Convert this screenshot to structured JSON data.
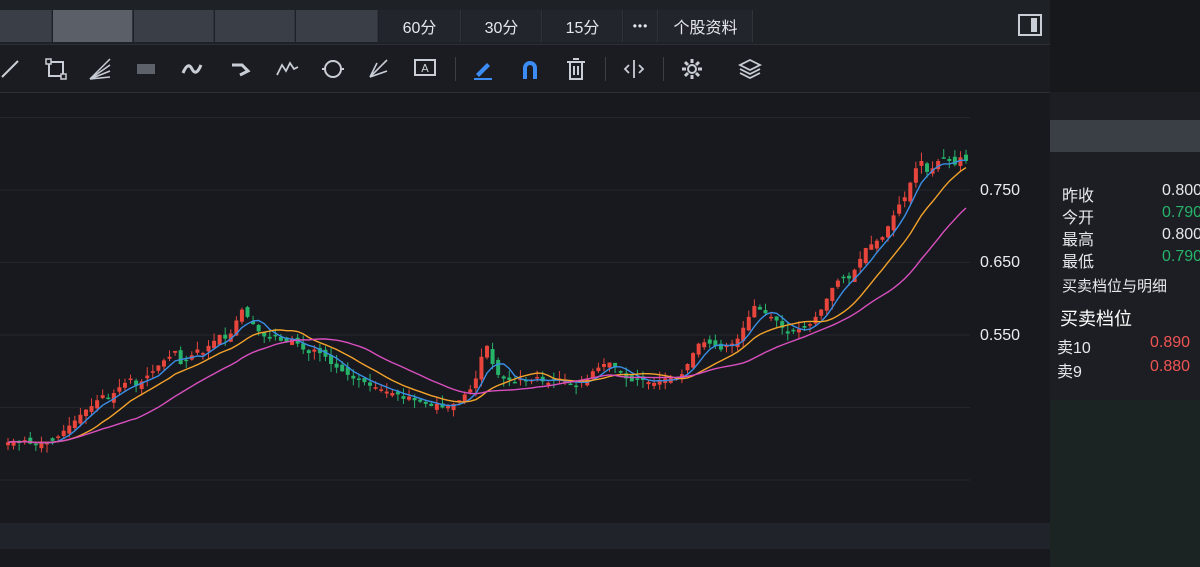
{
  "tabs": {
    "blurred": [
      "",
      "",
      "",
      "",
      ""
    ],
    "t60": "60分",
    "t30": "30分",
    "t15": "15分",
    "more": "•••",
    "profile": "个股资料"
  },
  "toolbar": {
    "icons": [
      "line-tool-icon",
      "rectangle-tool-icon",
      "fan-tool-icon",
      "pattern-tool-icon",
      "wave-tool-icon",
      "arrow-tool-icon",
      "zigzag-tool-icon",
      "cycle-tool-icon",
      "fork-tool-icon",
      "text-note-icon",
      "pen-highlight-icon",
      "magnet-icon",
      "trash-icon",
      "fit-width-icon",
      "settings-icon",
      "layers-icon"
    ],
    "accent": "#3b8cf5"
  },
  "chart": {
    "y_ticks": [
      "0.750",
      "0.650",
      "0.550"
    ],
    "colors": {
      "up": "#e8453c",
      "down": "#27b36a",
      "ma5": "#3a8ee6",
      "ma10": "#f3a22b",
      "ma20": "#d94fbf"
    }
  },
  "quote": {
    "rows": [
      {
        "label": "昨收",
        "value": "0.800",
        "color": "#e6e8ec"
      },
      {
        "label": "今开",
        "value": "0.790",
        "color": "#27b36a"
      },
      {
        "label": "最高",
        "value": "0.800",
        "color": "#e6e8ec"
      },
      {
        "label": "最低",
        "value": "0.790",
        "color": "#27b36a"
      }
    ],
    "section_title": "买卖档位与明细",
    "depth_title": "买卖档位",
    "sells": [
      {
        "label": "卖10",
        "value": "0.890"
      },
      {
        "label": "卖9",
        "value": "0.880"
      }
    ]
  },
  "chart_data": {
    "type": "candlestick",
    "y_ticks": [
      0.75,
      0.65,
      0.55
    ],
    "close": [
      0.402,
      0.404,
      0.401,
      0.405,
      0.4,
      0.398,
      0.403,
      0.402,
      0.404,
      0.41,
      0.418,
      0.425,
      0.432,
      0.44,
      0.447,
      0.452,
      0.46,
      0.467,
      0.462,
      0.47,
      0.478,
      0.484,
      0.49,
      0.48,
      0.486,
      0.494,
      0.5,
      0.508,
      0.515,
      0.52,
      0.528,
      0.51,
      0.515,
      0.522,
      0.53,
      0.525,
      0.535,
      0.542,
      0.55,
      0.545,
      0.552,
      0.57,
      0.585,
      0.575,
      0.565,
      0.555,
      0.548,
      0.545,
      0.55,
      0.542,
      0.54,
      0.545,
      0.538,
      0.53,
      0.525,
      0.53,
      0.525,
      0.52,
      0.51,
      0.505,
      0.5,
      0.495,
      0.49,
      0.488,
      0.485,
      0.48,
      0.478,
      0.475,
      0.472,
      0.47,
      0.468,
      0.462,
      0.465,
      0.46,
      0.458,
      0.455,
      0.452,
      0.455,
      0.45,
      0.452,
      0.455,
      0.46,
      0.468,
      0.475,
      0.49,
      0.52,
      0.535,
      0.51,
      0.495,
      0.49,
      0.488,
      0.485,
      0.49,
      0.486,
      0.488,
      0.492,
      0.486,
      0.484,
      0.488,
      0.49,
      0.486,
      0.482,
      0.48,
      0.486,
      0.49,
      0.5,
      0.505,
      0.51,
      0.512,
      0.505,
      0.498,
      0.49,
      0.486,
      0.49,
      0.488,
      0.485,
      0.484,
      0.488,
      0.49,
      0.492,
      0.49,
      0.496,
      0.51,
      0.525,
      0.538,
      0.54,
      0.538,
      0.535,
      0.53,
      0.536,
      0.538,
      0.545,
      0.56,
      0.575,
      0.59,
      0.585,
      0.58,
      0.575,
      0.57,
      0.56,
      0.552,
      0.555,
      0.558,
      0.56,
      0.565,
      0.575,
      0.585,
      0.6,
      0.615,
      0.625,
      0.63,
      0.628,
      0.64,
      0.655,
      0.67,
      0.675,
      0.68,
      0.685,
      0.7,
      0.715,
      0.73,
      0.74,
      0.76,
      0.78,
      0.79,
      0.775,
      0.78,
      0.79,
      0.795,
      0.79,
      0.785,
      0.795,
      0.79
    ]
  }
}
